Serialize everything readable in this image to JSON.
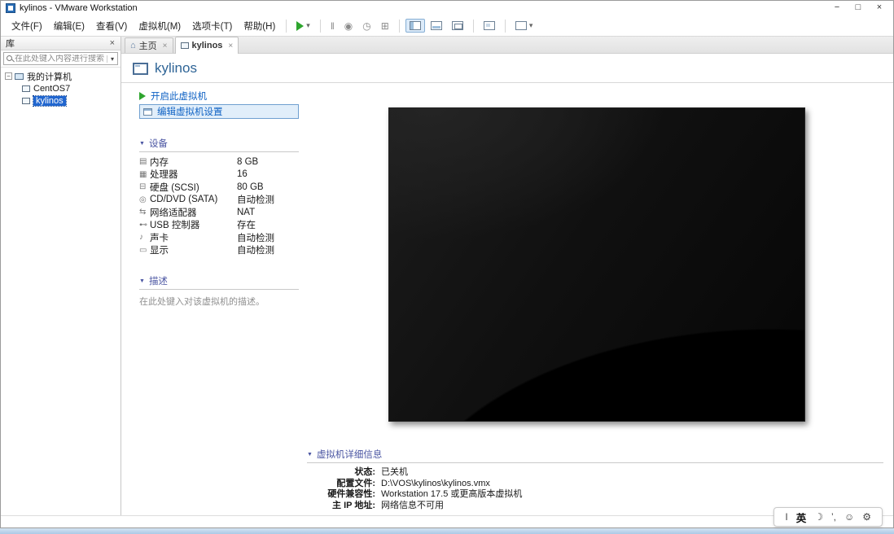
{
  "window": {
    "title": "kylinos - VMware Workstation",
    "controls": {
      "minimize": "−",
      "maximize": "□",
      "close": "×"
    }
  },
  "menu": {
    "items": [
      "文件(F)",
      "编辑(E)",
      "查看(V)",
      "虚拟机(M)",
      "选项卡(T)",
      "帮助(H)"
    ]
  },
  "toolbar": {
    "caret": "▾",
    "icons": {
      "suspend": "‖",
      "snapshot": "◉",
      "revert": "◷",
      "manager": "⊞"
    }
  },
  "sidebar": {
    "title": "库",
    "close": "×",
    "search_placeholder": "在此处键入内容进行搜索",
    "dropdown": "▾",
    "tree": {
      "expander": "−",
      "root": "我的计算机",
      "items": [
        {
          "name": "CentOS7"
        },
        {
          "name": "kylinos"
        }
      ]
    }
  },
  "tabs": {
    "home_icon": "⌂",
    "home": {
      "label": "主页",
      "close": "×"
    },
    "vm": {
      "label": "kylinos",
      "close": "×"
    }
  },
  "vm": {
    "title": "kylinos",
    "marker": "▼",
    "power_action": "开启此虚拟机",
    "edit_action": "编辑虚拟机设置",
    "devices_header": "设备",
    "devices": [
      {
        "icon": "▤",
        "name": "内存",
        "value": "8 GB"
      },
      {
        "icon": "▦",
        "name": "处理器",
        "value": "16"
      },
      {
        "icon": "⊟",
        "name": "硬盘 (SCSI)",
        "value": "80 GB"
      },
      {
        "icon": "◎",
        "name": "CD/DVD (SATA)",
        "value": "自动检测"
      },
      {
        "icon": "⇆",
        "name": "网络适配器",
        "value": "NAT"
      },
      {
        "icon": "⊷",
        "name": "USB 控制器",
        "value": "存在"
      },
      {
        "icon": "♪",
        "name": "声卡",
        "value": "自动检测"
      },
      {
        "icon": "▭",
        "name": "显示",
        "value": "自动检测"
      }
    ],
    "description_header": "描述",
    "description_placeholder": "在此处键入对该虚拟机的描述。",
    "details_header": "虚拟机详细信息",
    "details": [
      {
        "label": "状态:",
        "value": "已关机"
      },
      {
        "label": "配置文件:",
        "value": "D:\\VOS\\kylinos\\kylinos.vmx"
      },
      {
        "label": "硬件兼容性:",
        "value": "Workstation 17.5 或更高版本虚拟机"
      },
      {
        "label": "主 IP 地址:",
        "value": "网络信息不可用"
      }
    ]
  },
  "ime": {
    "items": [
      {
        "glyph": "I"
      },
      {
        "glyph": "英"
      },
      {
        "glyph": "☽"
      },
      {
        "glyph": "’,"
      },
      {
        "glyph": "☺"
      },
      {
        "glyph": "⚙"
      }
    ]
  }
}
